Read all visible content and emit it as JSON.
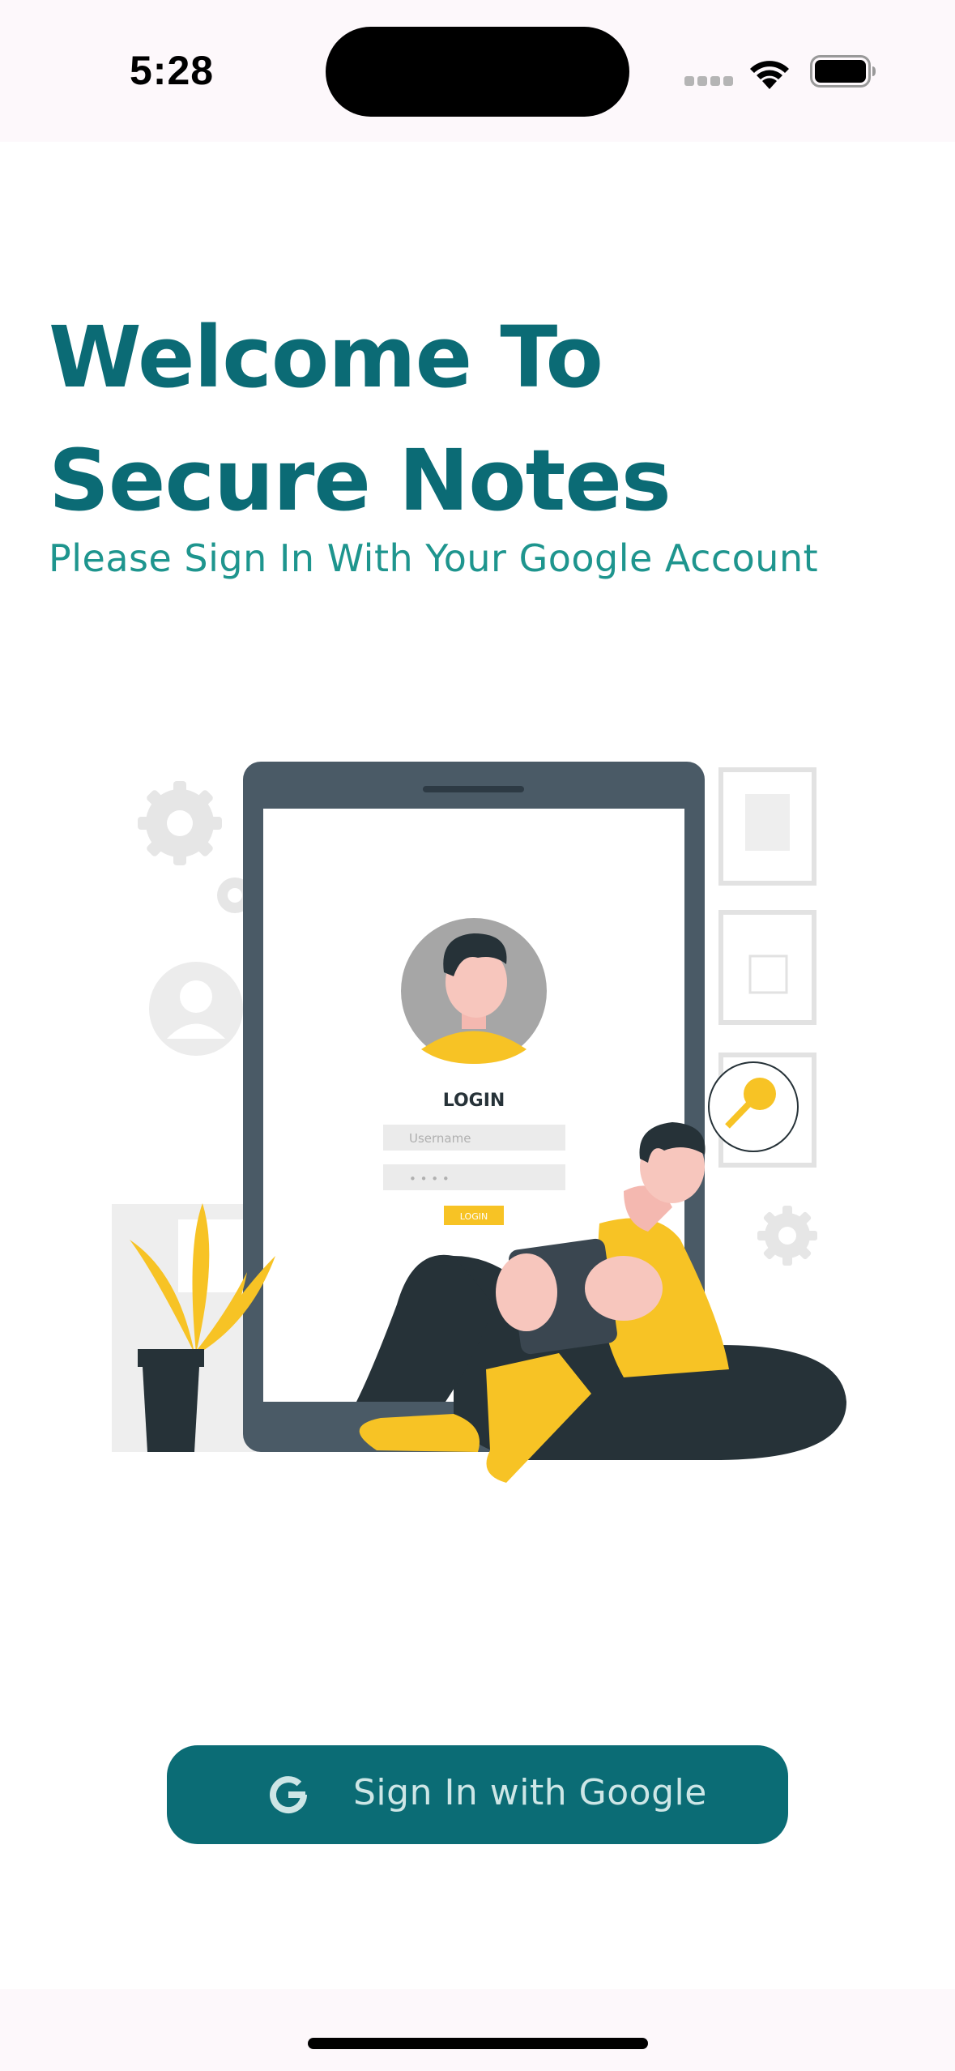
{
  "status_bar": {
    "time": "5:28",
    "icons": [
      "cellular-signal-icon",
      "wifi-icon",
      "battery-icon"
    ]
  },
  "header": {
    "title": "Welcome To Secure Notes",
    "subtitle": "Please Sign In With Your Google Account"
  },
  "illustration": {
    "login_label": "LOGIN",
    "username_placeholder": "Username",
    "password_mask": "• • • •",
    "login_button_label": "LOGIN"
  },
  "actions": {
    "google_sign_in_label": "Sign In with Google",
    "google_icon": "google-g-icon"
  },
  "colors": {
    "primary": "#0b6c75",
    "subtitle": "#1e958e",
    "accent_yellow": "#f7c325",
    "device_frame": "#4a5a66"
  }
}
